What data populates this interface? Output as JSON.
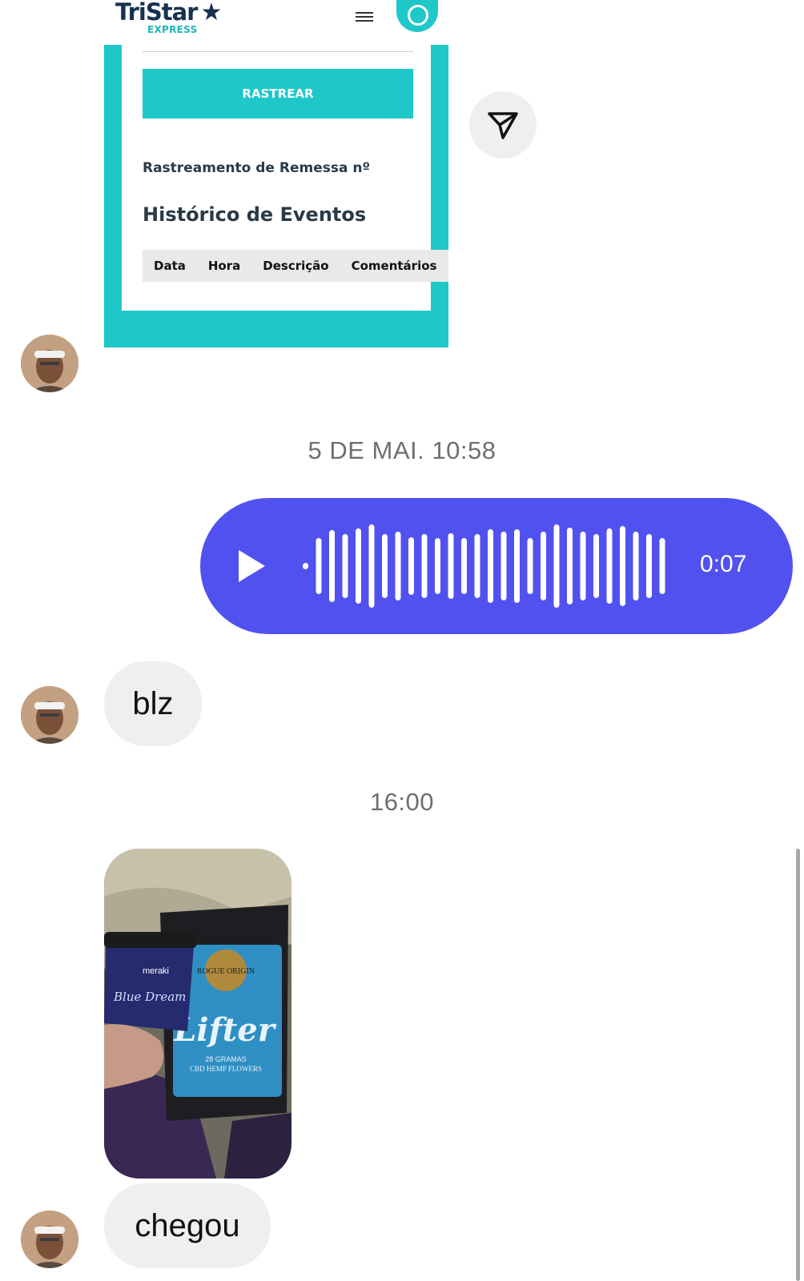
{
  "shared_screenshot": {
    "logo_main": "TriStar",
    "logo_sub": "EXPRESS",
    "track_button": "RASTREAR",
    "track_title": "Rastreamento de Remessa nº",
    "history_title": "Histórico de Eventos",
    "table_columns": [
      "Data",
      "Hora",
      "Descrição",
      "Comentários"
    ]
  },
  "timestamps": [
    "5 DE MAI. 10:58",
    "16:00"
  ],
  "voice_message": {
    "duration": "0:07"
  },
  "messages": [
    {
      "text": "blz"
    },
    {
      "text": "chegou"
    }
  ],
  "photo_labels": {
    "jar_brand": "meraki",
    "jar_name": "Blue Dream",
    "pouch_brand": "ROGUE ORIGIN",
    "pouch_name": "Lifter",
    "pouch_weight": "28 GRAMAS",
    "pouch_desc": "CBD HEMP FLOWERS"
  },
  "colors": {
    "accent_teal": "#1fc8c8",
    "voice_bubble": "#5151f0",
    "received_bubble": "#efefef"
  }
}
